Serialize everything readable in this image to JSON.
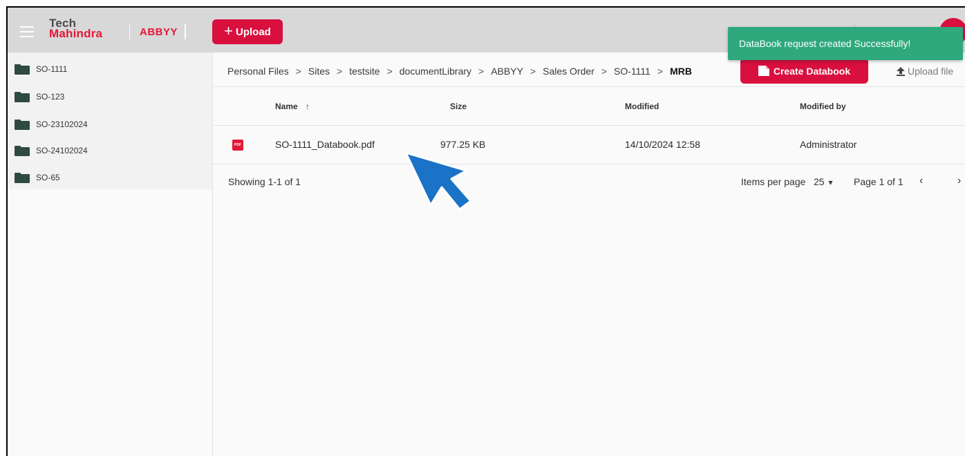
{
  "header": {
    "logo_line1": "Tech",
    "logo_line2": "Mahindra",
    "logo_abbyy": "ABBYY",
    "upload_label": "Upload",
    "upload_plus": "+"
  },
  "toast": {
    "message": "DataBook request created Successfully!",
    "color": "#2fa87d"
  },
  "sidebar": {
    "folders": [
      {
        "label": "SO-1111",
        "icon": "folder-icon"
      },
      {
        "label": "SO-123",
        "icon": "folder-icon"
      },
      {
        "label": "SO-23102024",
        "icon": "folder-icon"
      },
      {
        "label": "SO-24102024",
        "icon": "folder-icon"
      },
      {
        "label": "SO-65",
        "icon": "folder-icon"
      }
    ]
  },
  "breadcrumb": {
    "items": [
      "Personal Files",
      "Sites",
      "testsite",
      "documentLibrary",
      "ABBYY",
      "Sales Order",
      "SO-1111",
      "MRB"
    ],
    "separator": ">"
  },
  "toolbar": {
    "create_databook_label": "Create Databook",
    "upload_file_label": "Upload file"
  },
  "table": {
    "columns": {
      "name": "Name",
      "sort_indicator": "↑",
      "size": "Size",
      "modified": "Modified",
      "modified_by": "Modified by"
    },
    "rows": [
      {
        "icon_label": "PDF",
        "name": "SO-1111_Databook.pdf",
        "size": "977.25 KB",
        "modified": "14/10/2024 12:58",
        "modified_by": "Administrator"
      }
    ]
  },
  "pagination": {
    "showing": "Showing 1-1 of 1",
    "items_per_page_label": "Items per page",
    "items_per_page_value": "25",
    "dropdown_caret": "▾",
    "page_text": "Page 1 of 1",
    "prev": "‹",
    "next": "›"
  },
  "colors": {
    "brand_red": "#d90f3e",
    "header_bg": "#d8d8d8",
    "cursor_blue": "#1a73c6"
  }
}
